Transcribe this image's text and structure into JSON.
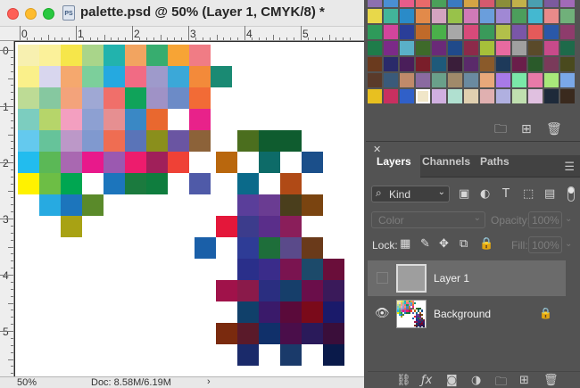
{
  "window": {
    "title": "palette.psd @ 50% (Layer 1, CMYK/8) *",
    "file_icon_label": "PS"
  },
  "rulers": {
    "top_labels": [
      "0",
      "1",
      "2",
      "3",
      "4",
      "5"
    ],
    "left_labels": [
      "0",
      "1",
      "2",
      "3",
      "4",
      "5"
    ]
  },
  "status": {
    "zoom": "50%",
    "doc_size": "Doc: 8.58M/6.19M",
    "arrow": "›"
  },
  "swatches_panel": {
    "colors": [
      "#8c70b0",
      "#4a8fd4",
      "#e85c8a",
      "#e86a6a",
      "#4aa05a",
      "#3b7ac0",
      "#d4a444",
      "#d65a6e",
      "#8a8e3a",
      "#c2b14a",
      "#4a9fb0",
      "#7c5a9e",
      "#a26ab8",
      "#e8d84a",
      "#42b59a",
      "#2a8bc8",
      "#e28a4a",
      "#d4a4c0",
      "#98c24a",
      "#d07ab8",
      "#6a9edc",
      "#a088d4",
      "#4c9e5c",
      "#44b8d0",
      "#e88a8a",
      "#70b07a",
      "#2e9a5a",
      "#d2459c",
      "#2a3e98",
      "#c06a2a",
      "#4ab04a",
      "#a8a8a8",
      "#d84a7a",
      "#3a9a5a",
      "#b2c04a",
      "#7a56a8",
      "#e45a5a",
      "#2a58a8",
      "#8e3c6c",
      "#1e7c4a",
      "#7c2a88",
      "#5ab0c8",
      "#3e6a2a",
      "#6a2a78",
      "#204a8a",
      "#8c2a4a",
      "#a6c03a",
      "#e86aa0",
      "#a0a0a0",
      "#5a4a2a",
      "#c84a8a",
      "#1e6a4a",
      "#6a3a1e",
      "#2a2a6a",
      "#4a1e5a",
      "#7a1e2a",
      "#1e5a7a",
      "#3a1e3a",
      "#5a2a6a",
      "#8a5a2a",
      "#1e3a5a",
      "#6a1e4a",
      "#2a5a2a",
      "#7a3a5a",
      "#4a4a1e",
      "#5a3a2a",
      "#3a5a7a",
      "#c08a6a",
      "#8a6aa0",
      "#6aa08a",
      "#a08a6a",
      "#6a8aa0",
      "#e8a87a",
      "#a87ae8",
      "#7ae8a8",
      "#e87aa8",
      "#a8e87a",
      "#7aa8e8",
      "#e8c020",
      "#c83060",
      "#3060c8",
      "#f0e6c8",
      "#d0b0e0",
      "#b0e0d0",
      "#e0d0b0",
      "#e0b0b0",
      "#b0b0e0",
      "#c0e0b0",
      "#e0c0e0",
      "#1e2a3a",
      "#3a2a1e"
    ],
    "selected_index": 81,
    "footer_icons": [
      "folder-icon",
      "new-swatch-icon",
      "trash-icon"
    ]
  },
  "layers_panel": {
    "tabs": [
      {
        "label": "Layers",
        "active": true
      },
      {
        "label": "Channels",
        "active": false
      },
      {
        "label": "Paths",
        "active": false
      }
    ],
    "filter_kind": "Kind",
    "blend_mode": "Color",
    "opacity_label": "Opacity:",
    "opacity_value": "100%",
    "lock_label": "Lock:",
    "fill_label": "Fill:",
    "fill_value": "100%",
    "layers": [
      {
        "name": "Layer 1",
        "visible": false,
        "selected": true,
        "locked": false
      },
      {
        "name": "Background",
        "visible": true,
        "selected": false,
        "locked": true
      }
    ]
  }
}
